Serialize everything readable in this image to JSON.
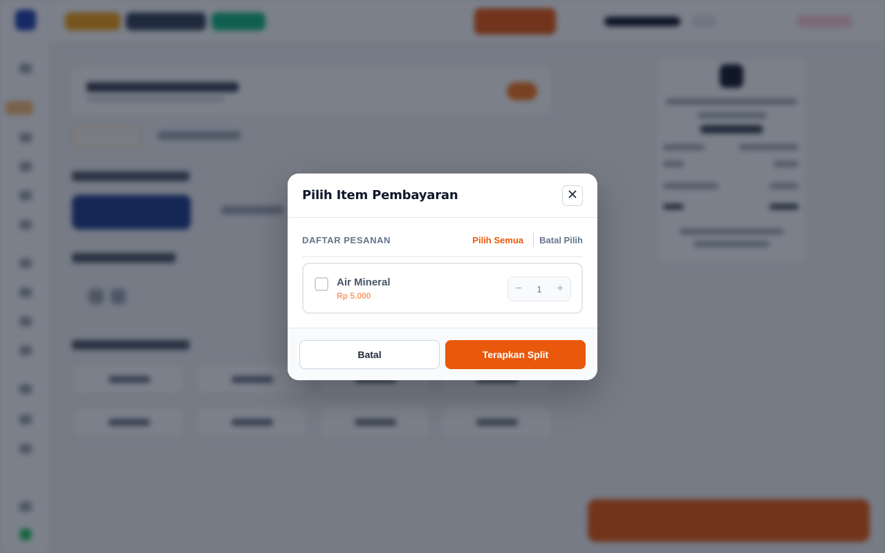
{
  "modal": {
    "title": "Pilih Item Pembayaran",
    "close_icon": "close-icon",
    "list_header": "DAFTAR PESANAN",
    "select_all": "Pilih Semua",
    "deselect_all": "Batal Pilih",
    "items": [
      {
        "name": "Air Mineral",
        "price": "Rp 5.000",
        "quantity": "1",
        "checked": false,
        "minus_symbol": "−",
        "plus_symbol": "+"
      }
    ],
    "cancel_label": "Batal",
    "apply_label": "Terapkan Split"
  },
  "colors": {
    "accent": "#ea580c",
    "overlay": "rgba(15,23,42,0.55)",
    "title": "#0f172a"
  }
}
